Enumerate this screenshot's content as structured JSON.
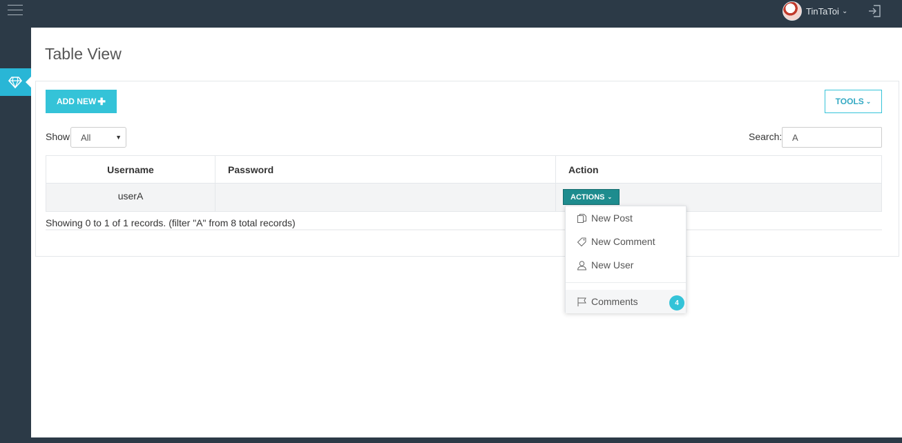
{
  "header": {
    "username": "TinTaToi"
  },
  "page": {
    "title": "Table View"
  },
  "toolbar": {
    "add_label": "ADD NEW",
    "tools_label": "TOOLS"
  },
  "filters": {
    "show_label": "Show",
    "show_value": "All",
    "search_label": "Search:",
    "search_value": "A"
  },
  "table": {
    "columns": [
      "Username",
      "Password",
      "Action"
    ],
    "rows": [
      {
        "username": "userA",
        "password": "",
        "action_label": "ACTIONS"
      }
    ]
  },
  "footer": {
    "showing_text": "Showing 0 to 1 of 1 records. (filter \"A\" from 8 total records)"
  },
  "actions_menu": {
    "items": [
      {
        "label": "New Post",
        "icon": "copy-icon"
      },
      {
        "label": "New Comment",
        "icon": "tag-icon"
      },
      {
        "label": "New User",
        "icon": "user-icon"
      },
      {
        "label": "Comments",
        "icon": "flag-icon",
        "badge": "4"
      }
    ]
  },
  "colors": {
    "accent": "#34c3d8",
    "topbar": "#2c3a47",
    "actions_button": "#1e8c8e"
  }
}
